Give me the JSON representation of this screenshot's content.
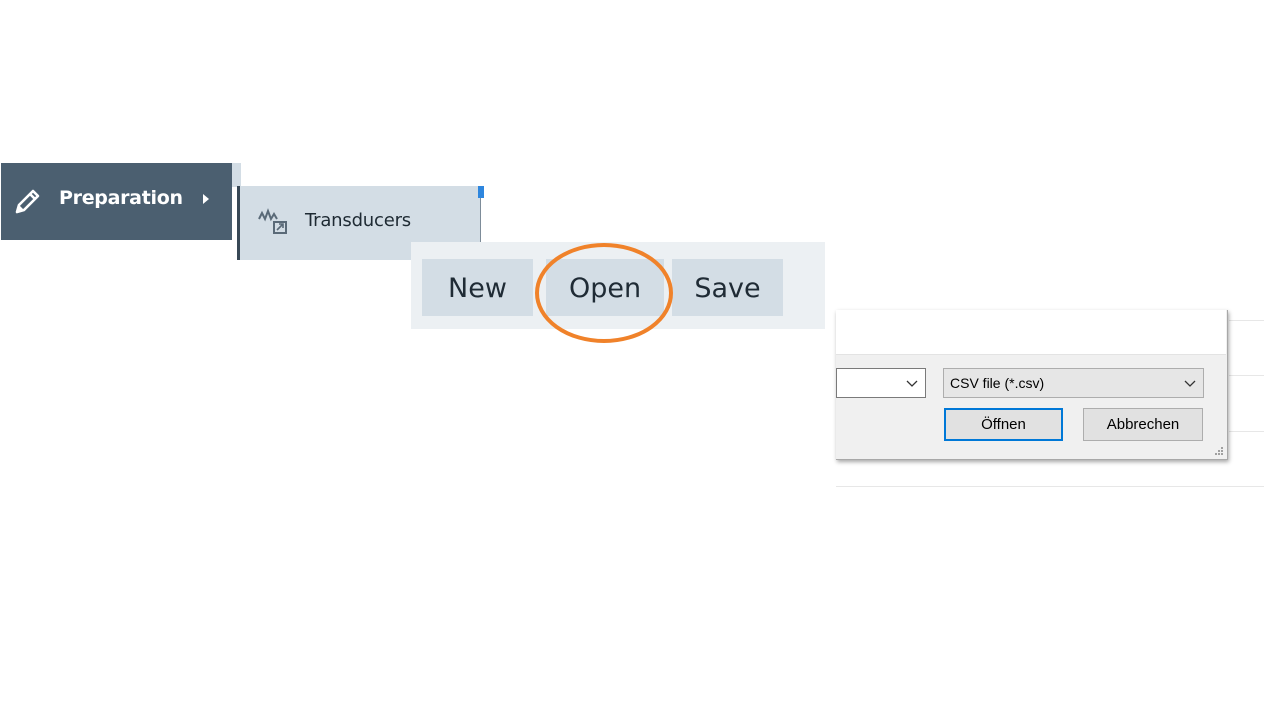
{
  "nav": {
    "preparation_label": "Preparation",
    "transducers_label": "Transducers"
  },
  "actions": {
    "new_label": "New",
    "open_label": "Open",
    "save_label": "Save",
    "highlight_color": "#f0822a"
  },
  "dialog": {
    "filename_value": "",
    "filetype_value": "CSV file (*.csv)",
    "open_button_label": "Öffnen",
    "cancel_button_label": "Abbrechen",
    "default_button_border": "#0078d7"
  },
  "colors": {
    "nav_bg": "#4b5f70",
    "submenu_bg": "#d3dde5",
    "action_bar_bg": "#ecf0f3"
  }
}
